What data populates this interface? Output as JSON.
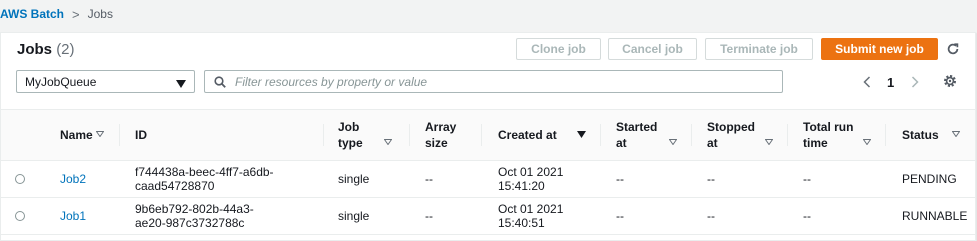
{
  "breadcrumb": {
    "root": "AWS Batch",
    "separator": ">",
    "current": "Jobs"
  },
  "header": {
    "title": "Jobs",
    "count": "(2)"
  },
  "toolbar": {
    "clone": "Clone job",
    "cancel": "Cancel job",
    "terminate": "Terminate job",
    "submit": "Submit new job"
  },
  "filter": {
    "queue_selected": "MyJobQueue",
    "search_placeholder": "Filter resources by property or value"
  },
  "pagination": {
    "page": "1"
  },
  "columns": {
    "name": "Name",
    "id": "ID",
    "job_type_1": "Job",
    "job_type_2": "type",
    "array_1": "Array",
    "array_2": "size",
    "created": "Created at",
    "started_1": "Started",
    "started_2": "at",
    "stopped_1": "Stopped",
    "stopped_2": "at",
    "runtime_1": "Total run",
    "runtime_2": "time",
    "status": "Status"
  },
  "rows": [
    {
      "name": "Job2",
      "id_1": "f744438a-beec-4ff7-a6db-",
      "id_2": "caad54728870",
      "type": "single",
      "array": "--",
      "created_1": "Oct 01 2021",
      "created_2": "15:41:20",
      "started": "--",
      "stopped": "--",
      "runtime": "--",
      "status": "PENDING"
    },
    {
      "name": "Job1",
      "id_1": "9b6eb792-802b-44a3-",
      "id_2": "ae20-987c3732788c",
      "type": "single",
      "array": "--",
      "created_1": "Oct 01 2021",
      "created_2": "15:40:51",
      "started": "--",
      "stopped": "--",
      "runtime": "--",
      "status": "RUNNABLE"
    }
  ],
  "colors": {
    "link": "#0073bb",
    "primary": "#ec7211",
    "disabled_text": "#aab7b8"
  }
}
